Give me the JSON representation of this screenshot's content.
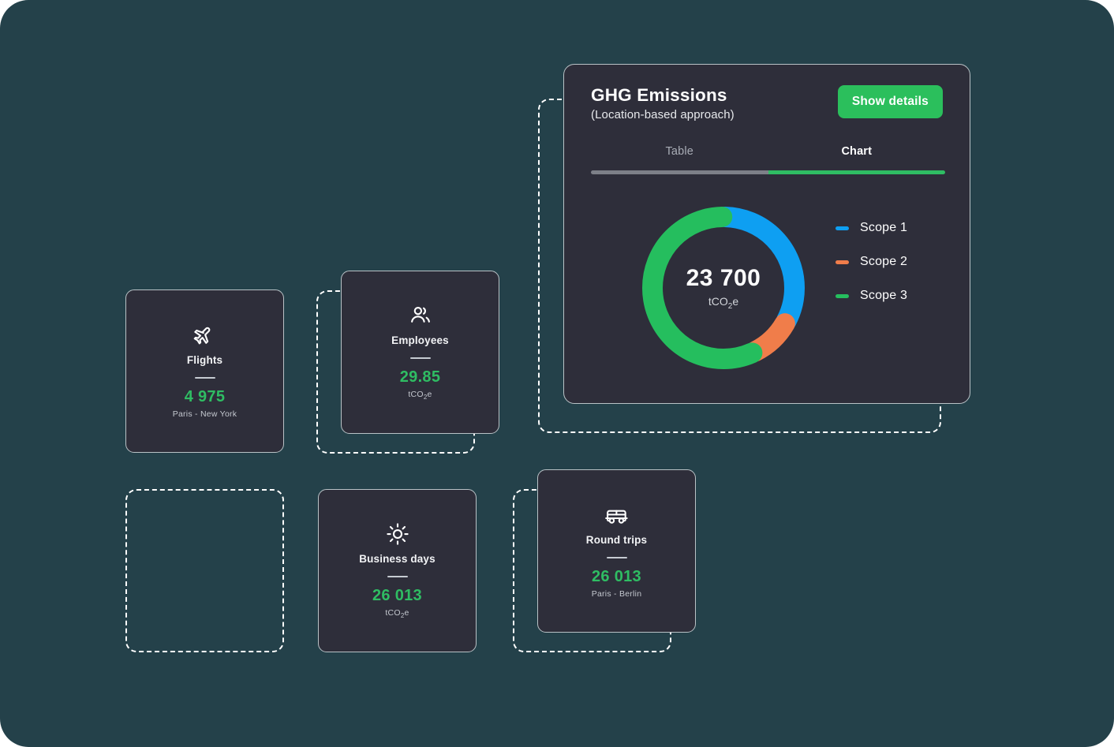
{
  "theme": {
    "page_background": "#24414a",
    "card_background": "#2e2e3a",
    "accent_green": "#2fbd63",
    "scope1_blue": "#0e9ff2",
    "scope2_orange": "#f07d4a",
    "scope3_green": "#25be5e"
  },
  "cards": [
    {
      "id": "flights",
      "icon": "airplane-icon",
      "title": "Flights",
      "value": "4 975",
      "sub": "Paris - New York"
    },
    {
      "id": "employees",
      "icon": "people-icon",
      "title": "Employees",
      "value": "29.85",
      "sub": "tCO₂e"
    },
    {
      "id": "business-days",
      "icon": "sun-icon",
      "title": "Business days",
      "value": "26 013",
      "sub": "tCO₂e"
    },
    {
      "id": "round-trips",
      "icon": "car-icon",
      "title": "Round trips",
      "value": "26 013",
      "sub": "Paris - Berlin"
    }
  ],
  "ghg_panel": {
    "title": "GHG Emissions",
    "subtitle": "(Location-based approach)",
    "show_details_label": "Show details",
    "tabs": [
      {
        "label": "Table",
        "active": false
      },
      {
        "label": "Chart",
        "active": true
      }
    ],
    "center_value": "23 700",
    "center_unit": "tCO₂e"
  },
  "chart_data": {
    "type": "pie",
    "title": "GHG Emissions",
    "subtitle": "(Location-based approach)",
    "variant": "donut",
    "total": 23700,
    "unit": "tCO2e",
    "center_label": "23 700",
    "center_unit": "tCO₂e",
    "legend_position": "right",
    "categories": [
      "Scope 1",
      "Scope 2",
      "Scope 3"
    ],
    "values": [
      7821,
      2370,
      13509
    ],
    "percentages": [
      33,
      10,
      57
    ],
    "colors": [
      "#0e9ff2",
      "#f07d4a",
      "#25be5e"
    ],
    "start_angle_deg": 0,
    "direction": "clockwise",
    "rounded_caps": true
  }
}
